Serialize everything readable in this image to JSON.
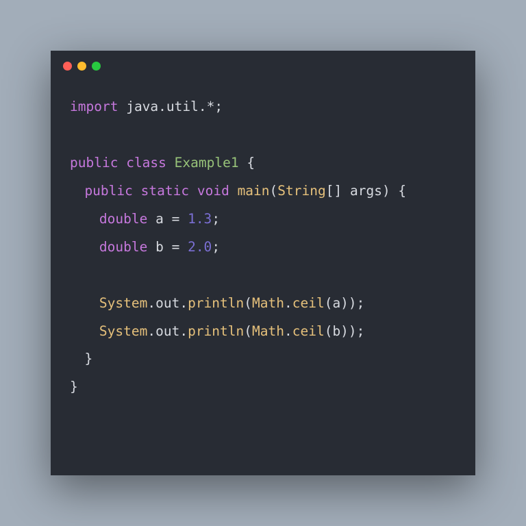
{
  "window": {
    "controls": [
      "close",
      "minimize",
      "zoom"
    ]
  },
  "code": {
    "language": "java",
    "lines": [
      {
        "indent": 0,
        "tokens": [
          {
            "t": "import",
            "c": "keyword"
          },
          {
            "t": " ",
            "c": "default"
          },
          {
            "t": "java",
            "c": "default"
          },
          {
            "t": ".",
            "c": "punct"
          },
          {
            "t": "util",
            "c": "default"
          },
          {
            "t": ".*;",
            "c": "punct"
          }
        ]
      },
      {
        "indent": 0,
        "tokens": []
      },
      {
        "indent": 0,
        "tokens": [
          {
            "t": "public",
            "c": "keyword"
          },
          {
            "t": " ",
            "c": "default"
          },
          {
            "t": "class",
            "c": "keyword"
          },
          {
            "t": " ",
            "c": "default"
          },
          {
            "t": "Example1",
            "c": "classname"
          },
          {
            "t": " {",
            "c": "punct"
          }
        ]
      },
      {
        "indent": 1,
        "tokens": [
          {
            "t": "public",
            "c": "keyword"
          },
          {
            "t": " ",
            "c": "default"
          },
          {
            "t": "static",
            "c": "keyword"
          },
          {
            "t": " ",
            "c": "default"
          },
          {
            "t": "void",
            "c": "keyword"
          },
          {
            "t": " ",
            "c": "default"
          },
          {
            "t": "main",
            "c": "method"
          },
          {
            "t": "(",
            "c": "punct"
          },
          {
            "t": "String",
            "c": "builtin"
          },
          {
            "t": "[] ",
            "c": "punct"
          },
          {
            "t": "args",
            "c": "default"
          },
          {
            "t": ") {",
            "c": "punct"
          }
        ]
      },
      {
        "indent": 2,
        "tokens": [
          {
            "t": "double",
            "c": "keyword"
          },
          {
            "t": " a ",
            "c": "default"
          },
          {
            "t": "=",
            "c": "operator"
          },
          {
            "t": " ",
            "c": "default"
          },
          {
            "t": "1.3",
            "c": "number"
          },
          {
            "t": ";",
            "c": "punct"
          }
        ]
      },
      {
        "indent": 2,
        "tokens": [
          {
            "t": "double",
            "c": "keyword"
          },
          {
            "t": " b ",
            "c": "default"
          },
          {
            "t": "=",
            "c": "operator"
          },
          {
            "t": " ",
            "c": "default"
          },
          {
            "t": "2.0",
            "c": "number"
          },
          {
            "t": ";",
            "c": "punct"
          }
        ]
      },
      {
        "indent": 0,
        "tokens": []
      },
      {
        "indent": 2,
        "tokens": [
          {
            "t": "System",
            "c": "builtin"
          },
          {
            "t": ".",
            "c": "punct"
          },
          {
            "t": "out",
            "c": "default"
          },
          {
            "t": ".",
            "c": "punct"
          },
          {
            "t": "println",
            "c": "method"
          },
          {
            "t": "(",
            "c": "punct"
          },
          {
            "t": "Math",
            "c": "builtin"
          },
          {
            "t": ".",
            "c": "punct"
          },
          {
            "t": "ceil",
            "c": "method"
          },
          {
            "t": "(a));",
            "c": "punct"
          }
        ]
      },
      {
        "indent": 2,
        "tokens": [
          {
            "t": "System",
            "c": "builtin"
          },
          {
            "t": ".",
            "c": "punct"
          },
          {
            "t": "out",
            "c": "default"
          },
          {
            "t": ".",
            "c": "punct"
          },
          {
            "t": "println",
            "c": "method"
          },
          {
            "t": "(",
            "c": "punct"
          },
          {
            "t": "Math",
            "c": "builtin"
          },
          {
            "t": ".",
            "c": "punct"
          },
          {
            "t": "ceil",
            "c": "method"
          },
          {
            "t": "(b));",
            "c": "punct"
          }
        ]
      },
      {
        "indent": 1,
        "tokens": [
          {
            "t": "}",
            "c": "punct"
          }
        ]
      },
      {
        "indent": 0,
        "tokens": [
          {
            "t": "}",
            "c": "punct"
          }
        ]
      }
    ]
  }
}
